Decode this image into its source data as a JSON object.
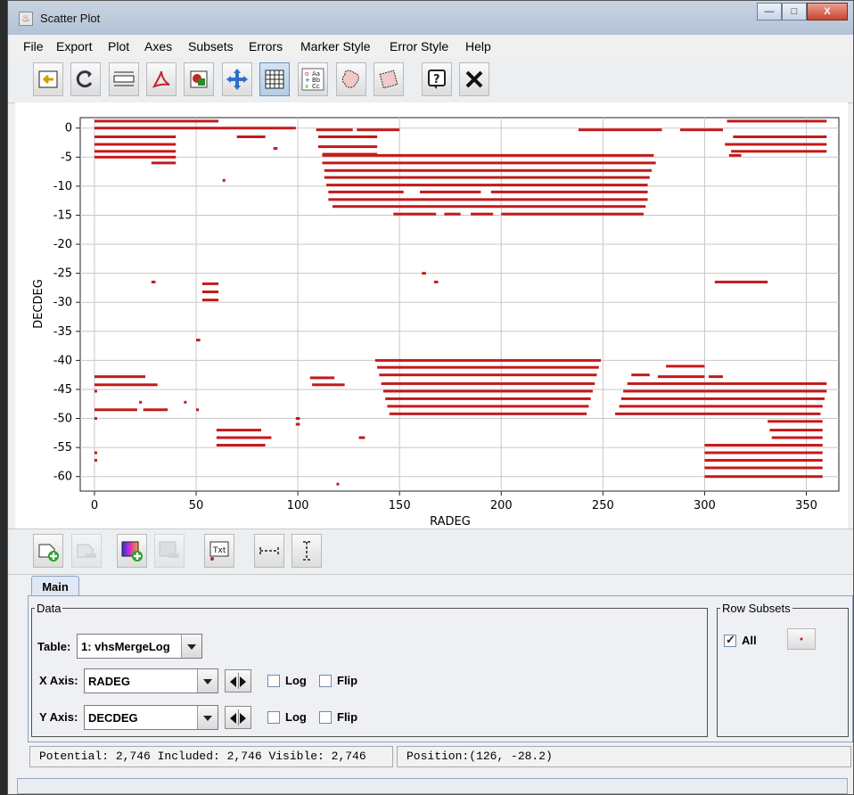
{
  "window": {
    "title": "Scatter Plot",
    "minimize": "—",
    "maximize": "□",
    "close": "X"
  },
  "menu": [
    "File",
    "Export",
    "Plot",
    "Axes",
    "Subsets",
    "Errors",
    "Marker Style",
    "Error Style",
    "Help"
  ],
  "toolbar_icons": [
    "import-icon",
    "replot-icon",
    "title-icon",
    "pdf-export-icon",
    "image-export-icon",
    "zoom-pan-icon",
    "grid-icon",
    "legend-icon",
    "subset-blob-icon",
    "subset-rectangle-icon",
    "help-icon",
    "close-icon"
  ],
  "tool2_icons": [
    "add-dataset-icon",
    "remove-dataset-icon",
    "add-aux-axis-icon",
    "remove-aux-axis-icon",
    "label-text-icon",
    "x-error-bar-icon",
    "y-error-bar-icon"
  ],
  "text_tool_label": "Txt",
  "tabs": {
    "main": "Main"
  },
  "data_panel": {
    "legend": "Data",
    "table_label": "Table:",
    "table_value": "1: vhsMergeLog",
    "x_label": "X Axis:",
    "x_value": "RADEG",
    "y_label": "Y Axis:",
    "y_value": "DECDEG",
    "log_label": "Log",
    "flip_label": "Flip"
  },
  "row_subsets": {
    "legend": "Row Subsets",
    "all_label": "All",
    "all_checked": true
  },
  "status": {
    "counts": "Potential: 2,746 Included: 2,746 Visible: 2,746",
    "position": "Position:(126, -28.2)"
  },
  "colors": {
    "marker": "#c41a1a",
    "grid": "#c8c8c8"
  },
  "chart_data": {
    "type": "scatter",
    "xlabel": "RADEG",
    "ylabel": "DECDEG",
    "xlim": [
      -7,
      366
    ],
    "ylim": [
      -62.5,
      1.8
    ],
    "xticks": [
      0,
      50,
      100,
      150,
      200,
      250,
      300,
      350
    ],
    "yticks": [
      0,
      -5,
      -10,
      -15,
      -20,
      -25,
      -30,
      -35,
      -40,
      -45,
      -50,
      -55,
      -60
    ],
    "grid": true,
    "point_runs": [
      {
        "y": 1.2,
        "x": [
          [
            0,
            61
          ],
          [
            311,
            360
          ]
        ]
      },
      {
        "y": 0,
        "x": [
          [
            0,
            99
          ]
        ]
      },
      {
        "y": -0.3,
        "x": [
          [
            109,
            127
          ],
          [
            129,
            150
          ],
          [
            238,
            279
          ],
          [
            288,
            309
          ]
        ]
      },
      {
        "y": -1.5,
        "x": [
          [
            0,
            40
          ],
          [
            70,
            84
          ],
          [
            110,
            133
          ],
          [
            133,
            139
          ],
          [
            314,
            360
          ]
        ]
      },
      {
        "y": -2.8,
        "x": [
          [
            0,
            40
          ],
          [
            310,
            360
          ]
        ]
      },
      {
        "y": -3.2,
        "x": [
          [
            110,
            139
          ]
        ]
      },
      {
        "y": -3.5,
        "x": [
          [
            88,
            90
          ]
        ]
      },
      {
        "y": -4.0,
        "x": [
          [
            0,
            40
          ],
          [
            313,
            360
          ]
        ]
      },
      {
        "y": -4.5,
        "x": [
          [
            112,
            139
          ]
        ]
      },
      {
        "y": -4.7,
        "x": [
          [
            312,
            318
          ]
        ]
      },
      {
        "y": -5.0,
        "x": [
          [
            0,
            40
          ]
        ]
      },
      {
        "y": -4.7,
        "x": [
          [
            112,
            275
          ]
        ]
      },
      {
        "y": -6.0,
        "x": [
          [
            28,
            40
          ],
          [
            112,
            276
          ]
        ]
      },
      {
        "y": -7.3,
        "x": [
          [
            113,
            274
          ]
        ]
      },
      {
        "y": -8.5,
        "x": [
          [
            113,
            273
          ]
        ]
      },
      {
        "y": -9.0,
        "x": [
          [
            63,
            64
          ]
        ]
      },
      {
        "y": -9.8,
        "x": [
          [
            114,
            272
          ]
        ]
      },
      {
        "y": -11.0,
        "x": [
          [
            115,
            152
          ],
          [
            160,
            190
          ],
          [
            195,
            272
          ]
        ]
      },
      {
        "y": -12.3,
        "x": [
          [
            115,
            272
          ]
        ]
      },
      {
        "y": -13.5,
        "x": [
          [
            117,
            200
          ],
          [
            200,
            271
          ]
        ]
      },
      {
        "y": -14.8,
        "x": [
          [
            147,
            168
          ],
          [
            172,
            180
          ],
          [
            185,
            196
          ],
          [
            200,
            270
          ]
        ]
      },
      {
        "y": -25.0,
        "x": [
          [
            161,
            163
          ]
        ]
      },
      {
        "y": -26.5,
        "x": [
          [
            28,
            30
          ],
          [
            167,
            169
          ],
          [
            305,
            331
          ]
        ]
      },
      {
        "y": -26.8,
        "x": [
          [
            53,
            61
          ]
        ]
      },
      {
        "y": -28.2,
        "x": [
          [
            53,
            61
          ]
        ]
      },
      {
        "y": -29.6,
        "x": [
          [
            53,
            61
          ]
        ]
      },
      {
        "y": -36.5,
        "x": [
          [
            50,
            52
          ]
        ]
      },
      {
        "y": -40.0,
        "x": [
          [
            138,
            249
          ]
        ]
      },
      {
        "y": -41.0,
        "x": [
          [
            281,
            300
          ]
        ]
      },
      {
        "y": -41.2,
        "x": [
          [
            139,
            248
          ]
        ]
      },
      {
        "y": -42.5,
        "x": [
          [
            140,
            247
          ],
          [
            264,
            273
          ]
        ]
      },
      {
        "y": -42.8,
        "x": [
          [
            0,
            25
          ],
          [
            277,
            300
          ],
          [
            302,
            309
          ]
        ]
      },
      {
        "y": -43.0,
        "x": [
          [
            106,
            118
          ]
        ]
      },
      {
        "y": -44.0,
        "x": [
          [
            141,
            246
          ],
          [
            262,
            360
          ]
        ]
      },
      {
        "y": -44.2,
        "x": [
          [
            0,
            31
          ],
          [
            107,
            123
          ]
        ]
      },
      {
        "y": -45.3,
        "x": [
          [
            0,
            1
          ],
          [
            142,
            245
          ],
          [
            260,
            360
          ]
        ]
      },
      {
        "y": -46.6,
        "x": [
          [
            143,
            244
          ],
          [
            259,
            359
          ]
        ]
      },
      {
        "y": -47.2,
        "x": [
          [
            22,
            23
          ],
          [
            44,
            45
          ]
        ]
      },
      {
        "y": -47.9,
        "x": [
          [
            144,
            243
          ],
          [
            258,
            358
          ]
        ]
      },
      {
        "y": -48.5,
        "x": [
          [
            0,
            21
          ],
          [
            24,
            36
          ],
          [
            50,
            51
          ]
        ]
      },
      {
        "y": -49.2,
        "x": [
          [
            145,
            242
          ],
          [
            256,
            357
          ]
        ]
      },
      {
        "y": -50.0,
        "x": [
          [
            0,
            1
          ],
          [
            99,
            101
          ]
        ]
      },
      {
        "y": -50.5,
        "x": [
          [
            331,
            358
          ]
        ]
      },
      {
        "y": -51.0,
        "x": [
          [
            99,
            101
          ]
        ]
      },
      {
        "y": -52.0,
        "x": [
          [
            60,
            82
          ],
          [
            332,
            358
          ]
        ]
      },
      {
        "y": -53.3,
        "x": [
          [
            60,
            87
          ],
          [
            130,
            133
          ],
          [
            333,
            358
          ]
        ]
      },
      {
        "y": -54.6,
        "x": [
          [
            60,
            84
          ],
          [
            300,
            358
          ]
        ]
      },
      {
        "y": -55.9,
        "x": [
          [
            0,
            1
          ],
          [
            300,
            358
          ]
        ]
      },
      {
        "y": -57.2,
        "x": [
          [
            0,
            1
          ],
          [
            300,
            358
          ]
        ]
      },
      {
        "y": -58.5,
        "x": [
          [
            300,
            358
          ]
        ]
      },
      {
        "y": -60.0,
        "x": [
          [
            300,
            358
          ]
        ]
      },
      {
        "y": -61.3,
        "x": [
          [
            119,
            120
          ]
        ]
      }
    ]
  }
}
